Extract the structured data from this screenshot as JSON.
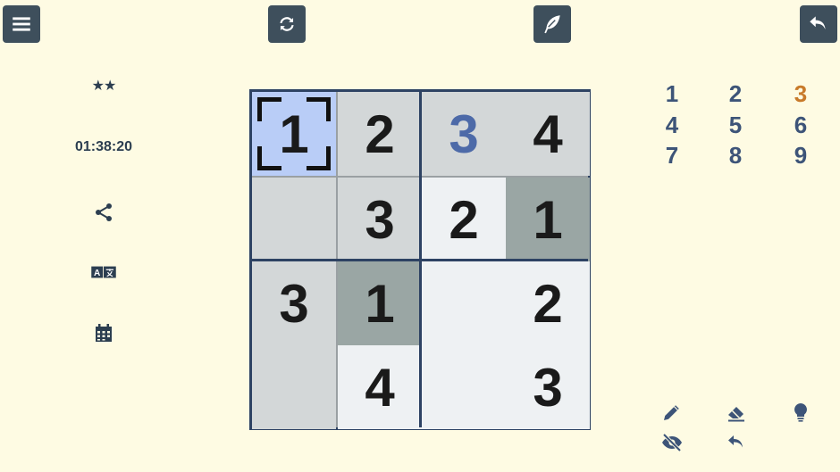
{
  "toolbar": {
    "menu": "menu-icon",
    "restart": "refresh-icon",
    "notes": "feather-icon",
    "undo": "undo-icon"
  },
  "side": {
    "stars": "★★",
    "timer": "01:38:20",
    "share": "share-icon",
    "translate": "translate-icon",
    "calendar": "calendar-icon"
  },
  "board": {
    "size": 4,
    "cells": [
      [
        "1",
        "2",
        "3",
        "4"
      ],
      [
        "",
        "3",
        "2",
        "1"
      ],
      [
        "3",
        "1",
        "",
        "2"
      ],
      [
        "",
        "4",
        "",
        "3"
      ]
    ],
    "selected": [
      0,
      0
    ],
    "user_entered": [
      [
        0,
        2
      ]
    ]
  },
  "numpad": {
    "digits": [
      "1",
      "2",
      "3",
      "4",
      "5",
      "6",
      "7",
      "8",
      "9"
    ],
    "highlighted": "3"
  },
  "tools": {
    "pencil": "pencil-icon",
    "eraser": "eraser-icon",
    "hint": "lightbulb-icon",
    "hide": "eye-slash-icon",
    "undo": "undo-icon"
  },
  "colors": {
    "background": "#fefbe3",
    "board_border": "#2d4263",
    "selected": "#b9cdf7",
    "user_digit": "#4d6aa8",
    "numpad_digit": "#3d5478",
    "numpad_highlight": "#c87a2a"
  }
}
